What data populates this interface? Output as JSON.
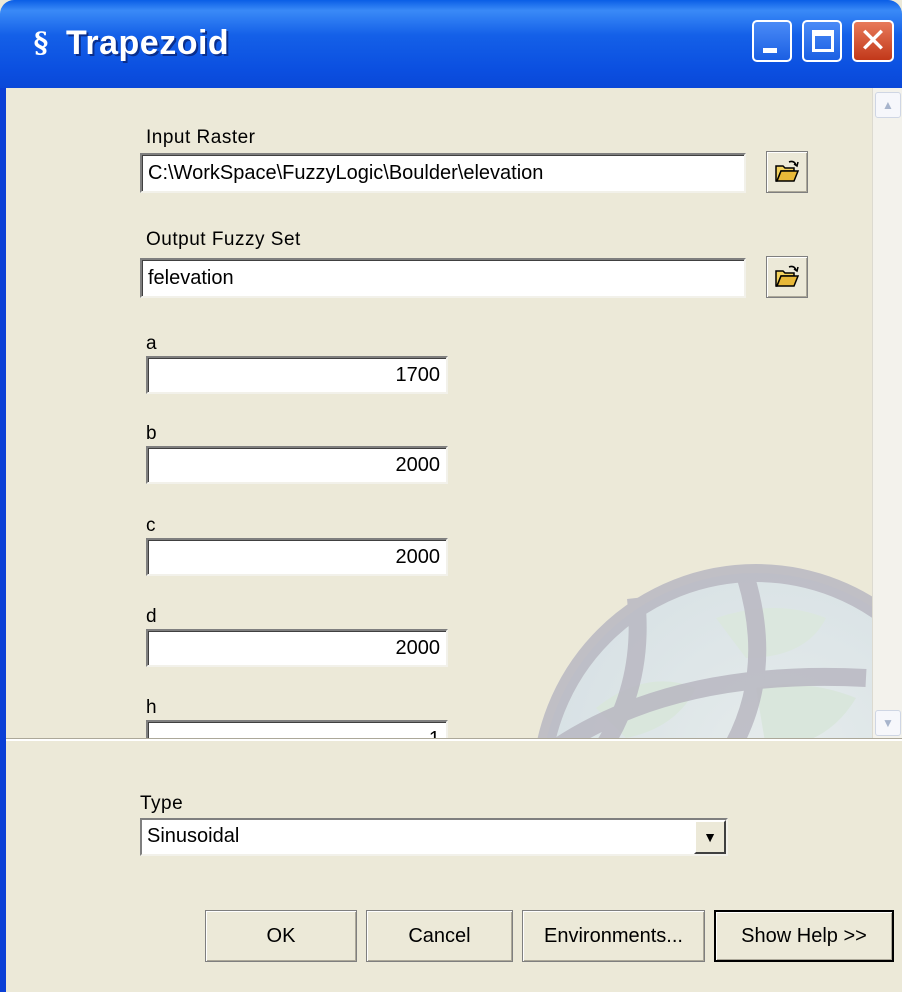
{
  "window": {
    "title": "Trapezoid",
    "controls": [
      "minimize-icon",
      "maximize-icon",
      "close-icon"
    ]
  },
  "form": {
    "input_raster": {
      "label": "Input Raster",
      "value": "C:\\WorkSpace\\FuzzyLogic\\Boulder\\elevation"
    },
    "output_fuzzy_set": {
      "label": "Output Fuzzy Set",
      "value": "felevation"
    },
    "a": {
      "label": "a",
      "value": "1700"
    },
    "b": {
      "label": "b",
      "value": "2000"
    },
    "c": {
      "label": "c",
      "value": "2000"
    },
    "d": {
      "label": "d",
      "value": "2000"
    },
    "h": {
      "label": "h",
      "value": "1"
    },
    "type": {
      "label": "Type",
      "selected": "Sinusoidal"
    }
  },
  "buttons": {
    "ok": "OK",
    "cancel": "Cancel",
    "environments": "Environments...",
    "show_help": "Show Help >>"
  },
  "colors": {
    "titlebar": "#0a4fe0",
    "dialog_bg": "#ece9d8",
    "close_button": "#d5532f"
  }
}
